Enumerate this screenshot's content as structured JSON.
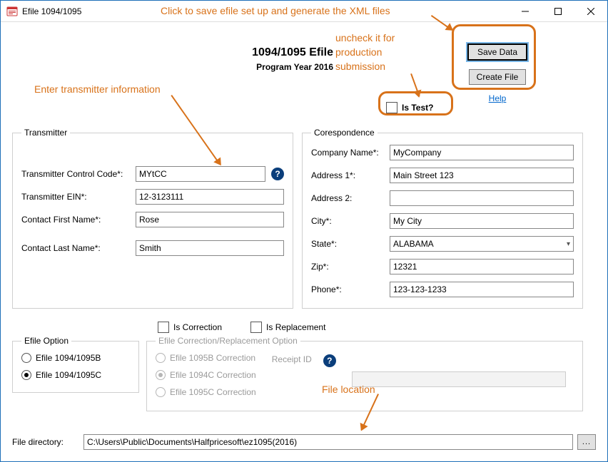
{
  "window": {
    "title": "Efile 1094/1095"
  },
  "header": {
    "title": "1094/1095 Efile",
    "program_year": "Program Year 2016"
  },
  "buttons": {
    "save": "Save Data",
    "create": "Create File",
    "help": "Help",
    "browse": "..."
  },
  "test": {
    "label": "Is Test?"
  },
  "transmitter": {
    "legend": "Transmitter",
    "tcc_label": "Transmitter Control Code*:",
    "tcc_value": "MYtCC",
    "ein_label": "Transmitter EIN*:",
    "ein_value": "12-3123111",
    "first_label": "Contact First Name*:",
    "first_value": "Rose",
    "last_label": "Contact Last Name*:",
    "last_value": "Smith"
  },
  "correspondence": {
    "legend": "Corespondence",
    "company_label": "Company Name*:",
    "company_value": "MyCompany",
    "addr1_label": "Address 1*:",
    "addr1_value": "Main Street 123",
    "addr2_label": "Address 2:",
    "addr2_value": "",
    "city_label": "City*:",
    "city_value": "My City",
    "state_label": "State*:",
    "state_value": "ALABAMA",
    "zip_label": "Zip*:",
    "zip_value": "12321",
    "phone_label": "Phone*:",
    "phone_value": "123-123-1233"
  },
  "efile_option": {
    "legend": "Efile Option",
    "b_label": "Efile 1094/1095B",
    "c_label": "Efile 1094/1095C",
    "selected": "c"
  },
  "flags": {
    "is_correction_label": "Is Correction",
    "is_replacement_label": "Is Replacement"
  },
  "correction_option": {
    "legend": "Efile Correction/Replacement Option",
    "b_corr": "Efile 1095B Correction",
    "c1094_corr": "Efile 1094C Correction",
    "c1095_corr": "Efile 1095C Correction",
    "receipt_label": "Receipt ID"
  },
  "file": {
    "dir_label": "File directory:",
    "dir_value": "C:\\Users\\Public\\Documents\\Halfpricesoft\\ez1095(2016)"
  },
  "annotations": {
    "a1": "Click to save efile set up and generate the XML files",
    "a2_line1": "uncheck it for",
    "a2_line2": "production",
    "a2_line3": "submission",
    "a3": "Enter transmitter information",
    "a4": "File location"
  },
  "colors": {
    "accent": "#d8721a",
    "link": "#0066cc",
    "border": "#1e6fb8"
  }
}
